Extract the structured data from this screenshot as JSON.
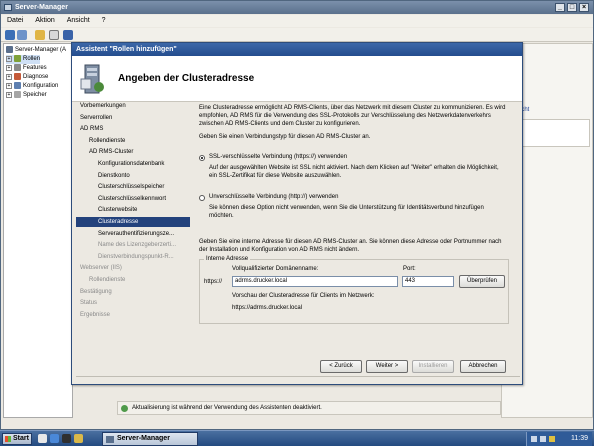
{
  "server_manager": {
    "title": "Server-Manager",
    "menu": [
      "Datei",
      "Aktion",
      "Ansicht",
      "?"
    ],
    "tree": [
      {
        "label": "Server-Manager (A",
        "level": 0
      },
      {
        "label": "Rollen",
        "level": 1
      },
      {
        "label": "Features",
        "level": 1
      },
      {
        "label": "Diagnose",
        "level": 1
      },
      {
        "label": "Konfiguration",
        "level": 1
      },
      {
        "label": "Speicher",
        "level": 1
      }
    ],
    "right_link": "icht",
    "status_text": "Aktualisierung ist während der Verwendung des Assistenten deaktiviert."
  },
  "wizard": {
    "title": "Assistent \"Rollen hinzufügen\"",
    "heading": "Angeben der Clusteradresse",
    "nav": [
      {
        "label": "Vorbemerkungen",
        "level": 1,
        "state": "normal"
      },
      {
        "label": "Serverrollen",
        "level": 1,
        "state": "normal"
      },
      {
        "label": "AD RMS",
        "level": 1,
        "state": "normal"
      },
      {
        "label": "Rollendienste",
        "level": 2,
        "state": "normal"
      },
      {
        "label": "AD RMS-Cluster",
        "level": 2,
        "state": "normal"
      },
      {
        "label": "Konfigurationsdatenbank",
        "level": 3,
        "state": "normal"
      },
      {
        "label": "Dienstkonto",
        "level": 3,
        "state": "normal"
      },
      {
        "label": "Clusterschlüsselspeicher",
        "level": 3,
        "state": "normal"
      },
      {
        "label": "Clusterschlüsselkennwort",
        "level": 3,
        "state": "normal"
      },
      {
        "label": "Clusterwebsite",
        "level": 3,
        "state": "normal"
      },
      {
        "label": "Clusteradresse",
        "level": 3,
        "state": "selected"
      },
      {
        "label": "Serverauthentifizierungsze...",
        "level": 3,
        "state": "normal"
      },
      {
        "label": "Name des Lizenzgeberzerti...",
        "level": 3,
        "state": "disabled"
      },
      {
        "label": "Dienstverbindungspunkt-R...",
        "level": 3,
        "state": "disabled"
      },
      {
        "label": "Webserver (IIS)",
        "level": 1,
        "state": "disabled"
      },
      {
        "label": "Rollendienste",
        "level": 2,
        "state": "disabled"
      },
      {
        "label": "Bestätigung",
        "level": 1,
        "state": "disabled"
      },
      {
        "label": "Status",
        "level": 1,
        "state": "disabled"
      },
      {
        "label": "Ergebnisse",
        "level": 1,
        "state": "disabled"
      }
    ],
    "intro": "Eine Clusteradresse ermöglicht AD RMS-Clients, über das Netzwerk mit diesem Cluster zu kommunizieren. Es wird empfohlen, AD RMS für die Verwendung des SSL-Protokolls zur Verschlüsselung des Netzwerkdatenverkehrs zwischen AD RMS-Clients und dem Cluster zu konfigurieren.",
    "choose_type": "Geben Sie einen Verbindungstyp für diesen AD RMS-Cluster an.",
    "option_ssl": "SSL-verschlüsselte Verbindung (https://) verwenden",
    "option_ssl_desc": "Auf der ausgewählten Website ist SSL nicht aktiviert. Nach dem Klicken auf \"Weiter\" erhalten die Möglichkeit, ein SSL-Zertifikat für diese Website auszuwählen.",
    "option_plain": "Unverschlüsselte Verbindung (http://) verwenden",
    "option_plain_desc": "Sie können diese Option nicht verwenden, wenn Sie die Unterstützung für Identitätsverbund hinzufügen möchten.",
    "internal_info": "Geben Sie eine interne Adresse für diesen AD RMS-Cluster an. Sie  können diese Adresse oder Portnummer nach der Installation und Konfiguration von AD RMS nicht ändern.",
    "group_label": "Interne Adresse",
    "fqdn_label": "Vollqualifizierter Domänenname:",
    "port_label": "Port:",
    "protocol": "https://",
    "fqdn_value": "adrms.drucker.local",
    "port_value": "443",
    "verify_button": "Überprüfen",
    "preview_label": "Vorschau der Clusteradresse für Clients im Netzwerk:",
    "preview_value": "https://adrms.drucker.local",
    "buttons": {
      "back": "< Zurück",
      "next": "Weiter >",
      "install": "Installieren",
      "cancel": "Abbrechen"
    }
  },
  "taskbar": {
    "start": "Start",
    "task": "Server-Manager",
    "time": "11:39"
  },
  "selected_option": "ssl"
}
